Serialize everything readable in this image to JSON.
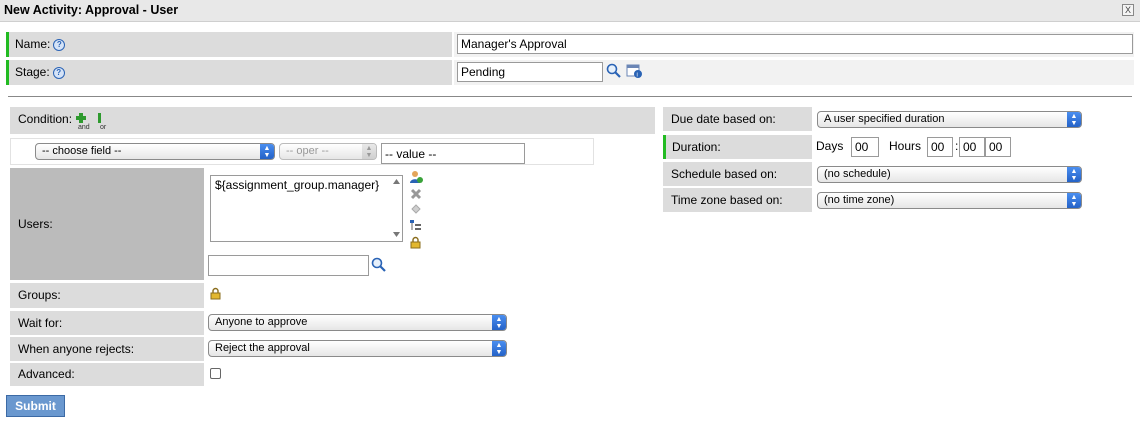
{
  "window": {
    "title": "New Activity: Approval - User",
    "close_label": "X"
  },
  "form": {
    "name": {
      "label": "Name:",
      "value": "Manager's Approval"
    },
    "stage": {
      "label": "Stage:",
      "value": "Pending"
    },
    "condition": {
      "label": "Condition:",
      "and_label": "and",
      "or_label": "or",
      "field_select": "-- choose field --",
      "oper_select": "-- oper --",
      "value_input": "-- value --"
    },
    "users": {
      "label": "Users:",
      "list": [
        "${assignment_group.manager}"
      ],
      "search_value": ""
    },
    "groups": {
      "label": "Groups:"
    },
    "wait_for": {
      "label": "Wait for:",
      "value": "Anyone to approve"
    },
    "when_rejects": {
      "label": "When anyone rejects:",
      "value": "Reject the approval"
    },
    "advanced": {
      "label": "Advanced:",
      "checked": false
    },
    "due_date": {
      "label": "Due date based on:",
      "value": "A user specified duration"
    },
    "duration": {
      "label": "Duration:",
      "days_label": "Days",
      "days_value": "00",
      "hours_label": "Hours",
      "hours_value": "00",
      "minutes_value": "00",
      "seconds_value": "00",
      "separator": ":"
    },
    "schedule": {
      "label": "Schedule based on:",
      "value": "(no schedule)"
    },
    "timezone": {
      "label": "Time zone based on:",
      "value": "(no time zone)"
    },
    "submit_label": "Submit"
  }
}
